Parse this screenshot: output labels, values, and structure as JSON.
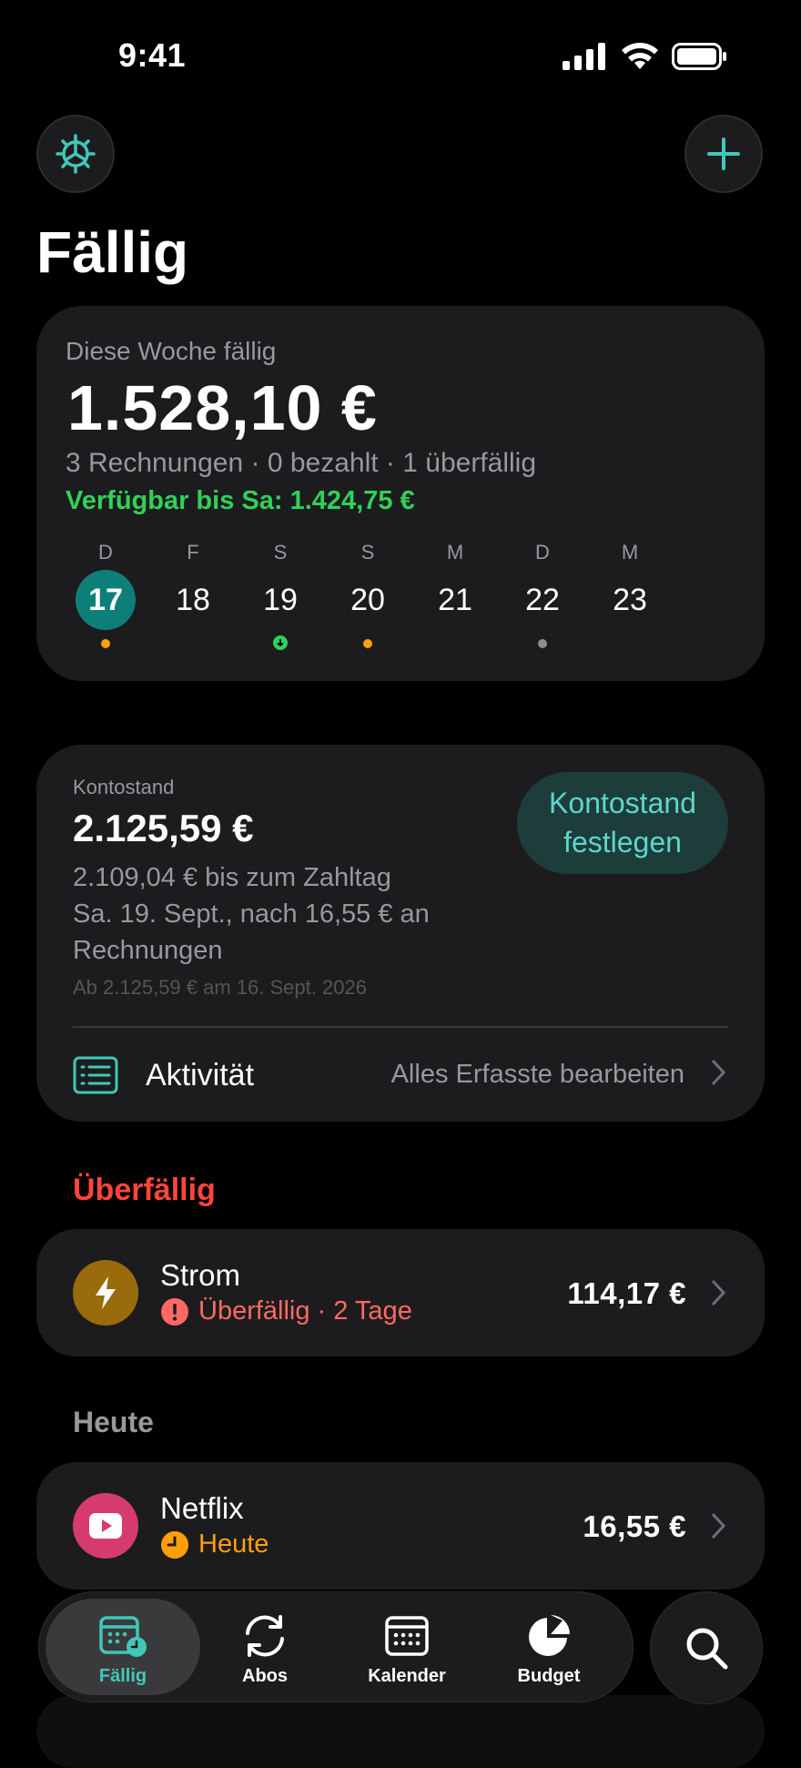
{
  "status_bar": {
    "time": "9:41"
  },
  "header": {
    "title": "Fällig"
  },
  "week_summary": {
    "label": "Diese Woche fällig",
    "amount": "1.528,10 €",
    "subtitle": "3 Rechnungen · 0 bezahlt · 1 überfällig",
    "available": "Verfügbar bis Sa: 1.424,75 €",
    "days": [
      {
        "letter": "D",
        "number": "17",
        "selected": true,
        "dot": "#ff9f0a"
      },
      {
        "letter": "F",
        "number": "18",
        "selected": false,
        "dot": null
      },
      {
        "letter": "S",
        "number": "19",
        "selected": false,
        "dot": "#30d158"
      },
      {
        "letter": "S",
        "number": "20",
        "selected": false,
        "dot": "#ff9f0a"
      },
      {
        "letter": "M",
        "number": "21",
        "selected": false,
        "dot": null
      },
      {
        "letter": "D",
        "number": "22",
        "selected": false,
        "dot": "#8e8e93"
      },
      {
        "letter": "M",
        "number": "23",
        "selected": false,
        "dot": null
      }
    ]
  },
  "balance": {
    "label": "Kontostand",
    "amount": "2.125,59 €",
    "line1": "2.109,04 € bis zum Zahltag",
    "line2": "Sa. 19. Sept., nach 16,55 € an",
    "line3": "Rechnungen",
    "note": "Ab 2.125,59 € am 16. Sept. 2026",
    "button_line1": "Kontostand",
    "button_line2": "festlegen",
    "activity_label": "Aktivität",
    "activity_link": "Alles Erfasste bearbeiten"
  },
  "sections": {
    "overdue": "Überfällig",
    "today": "Heute"
  },
  "bills": {
    "strom": {
      "name": "Strom",
      "status": "Überfällig · 2 Tage",
      "amount": "114,17 €",
      "icon": "bolt-icon",
      "color": "#9a6b0c"
    },
    "netflix": {
      "name": "Netflix",
      "status": "Heute",
      "amount": "16,55 €",
      "icon": "play-icon",
      "color": "#d63b6e"
    }
  },
  "tabbar": {
    "tabs": [
      {
        "label": "Fällig",
        "icon": "calendar-due-icon",
        "active": true
      },
      {
        "label": "Abos",
        "icon": "refresh-icon",
        "active": false
      },
      {
        "label": "Kalender",
        "icon": "calendar-icon",
        "active": false
      },
      {
        "label": "Budget",
        "icon": "pie-chart-icon",
        "active": false
      }
    ]
  },
  "colors": {
    "accent": "#40c8b8",
    "overdue": "#ff453a",
    "today": "#ff9f0a",
    "positive": "#30d158"
  }
}
